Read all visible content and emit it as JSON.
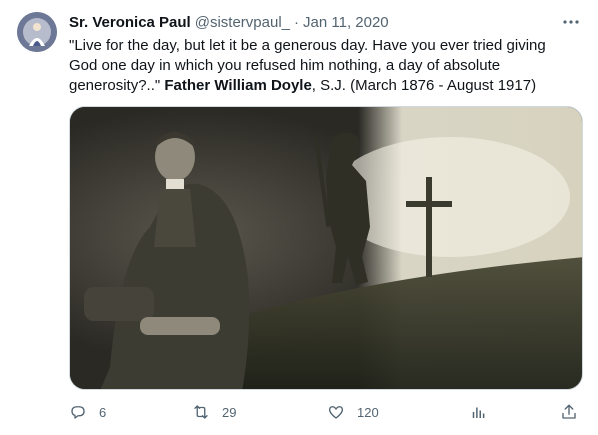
{
  "tweet": {
    "author_name": "Sr. Veronica Paul",
    "handle": "@sistervpaul_",
    "separator": "·",
    "date": "Jan 11, 2020",
    "text_part1": "\"Live for the day, but let it be a generous day. Have you ever tried giving God one day in which you refused him nothing, a day of absolute generosity?..\" ",
    "text_bold": "Father William Doyle",
    "text_part2": ", S.J. (March 1876 - August 1917)"
  },
  "actions": {
    "reply_count": "6",
    "retweet_count": "29",
    "like_count": "120"
  },
  "icons": {
    "avatar": "profile-avatar",
    "more": "more-icon",
    "reply": "reply-icon",
    "retweet": "retweet-icon",
    "like": "heart-icon",
    "views": "views-icon",
    "share": "share-icon"
  },
  "colors": {
    "text_primary": "#0f1419",
    "text_secondary": "#536471"
  }
}
